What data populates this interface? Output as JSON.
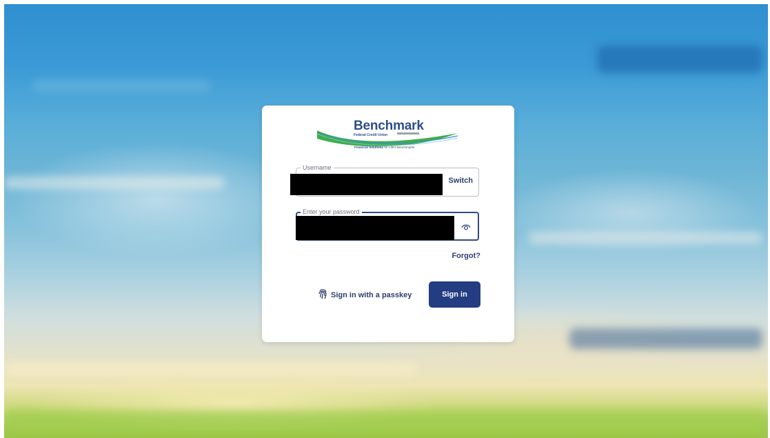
{
  "logo": {
    "brand": "Benchmark",
    "subtitle": "Federal Credit Union",
    "tagline_bold": "Financial Solutions",
    "tagline_rest": " for Life's Benchmarks"
  },
  "username": {
    "legend": "Username",
    "switch_label": "Switch"
  },
  "password": {
    "legend": "Enter your password",
    "toggle_icon": "eye-icon"
  },
  "links": {
    "forgot": "Forgot?"
  },
  "actions": {
    "passkey_label": "Sign in with a passkey",
    "passkey_icon": "fingerprint-icon",
    "signin_label": "Sign in"
  },
  "colors": {
    "brand_blue": "#2b4f8a",
    "button": "#233c82",
    "swoosh_green": "#3fae49",
    "swoosh_blue": "#3b8fd0"
  }
}
